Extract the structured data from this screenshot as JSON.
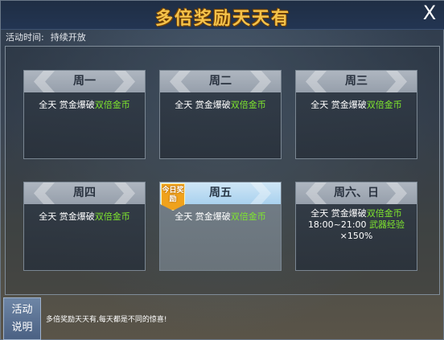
{
  "window": {
    "title": "多倍奖励天天有",
    "close_glyph": "X"
  },
  "info": {
    "label": "活动时间:",
    "value": "持续开放"
  },
  "days": [
    {
      "name": "周一",
      "line1_prefix": "全天  赏金爆破",
      "line1_highlight": "双倍金币"
    },
    {
      "name": "周二",
      "line1_prefix": "全天  赏金爆破",
      "line1_highlight": "双倍金币"
    },
    {
      "name": "周三",
      "line1_prefix": "全天  赏金爆破",
      "line1_highlight": "双倍金币"
    },
    {
      "name": "周四",
      "line1_prefix": "全天  赏金爆破",
      "line1_highlight": "双倍金币"
    },
    {
      "name": "周五",
      "line1_prefix": "全天  赏金爆破",
      "line1_highlight": "双倍金币",
      "badge": "今日奖励"
    },
    {
      "name": "周六、日",
      "line1_prefix": "全天  赏金爆破",
      "line1_highlight": "双倍金币",
      "line2_prefix": "18:00~21:00",
      "line2_highlight": "武器经验",
      "line3": "×150%"
    }
  ],
  "footer": {
    "button_label_1": "活动",
    "button_label_2": "说明",
    "description": "多倍奖励天天有,每天都是不同的惊喜!"
  },
  "colors": {
    "title": "#f4c24a",
    "highlight": "#7fe62e",
    "badge": "#f0a21c"
  }
}
